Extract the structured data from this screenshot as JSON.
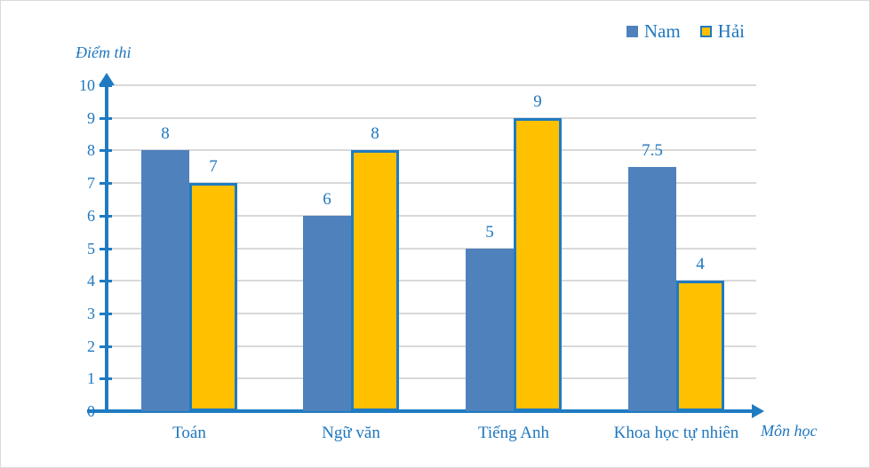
{
  "chart_data": {
    "type": "bar",
    "title": "",
    "subtitle": "",
    "xlabel": "Môn học",
    "ylabel": "Điểm thi",
    "ylim": [
      0,
      10
    ],
    "ytick_labels": [
      "10",
      "9",
      "8",
      "7",
      "6",
      "5",
      "4",
      "3",
      "2",
      "1",
      "0"
    ],
    "yticks": [
      10,
      9,
      8,
      7,
      6,
      5,
      4,
      3,
      2,
      1,
      0
    ],
    "grid": true,
    "legend_position": "top-right",
    "categories": [
      "Toán",
      "Ngữ văn",
      "Tiếng Anh",
      "Khoa học tự nhiên"
    ],
    "series": [
      {
        "name": "Nam",
        "color": "#4F81BD",
        "border_color": "",
        "values": [
          8,
          6,
          5,
          7.5
        ],
        "value_labels": [
          "8",
          "6",
          "5",
          "7.5"
        ]
      },
      {
        "name": "Hải",
        "color": "#FFC000",
        "border_color": "#1F7BC1",
        "values": [
          7,
          8,
          9,
          4
        ],
        "value_labels": [
          "7",
          "8",
          "9",
          "4"
        ]
      }
    ]
  },
  "colors": {
    "axis": "#1F7BC1",
    "text": "#1F77BE",
    "gridline": "#d9d9d9",
    "frame": "#d9d9d9",
    "series_nam": "#4F81BD",
    "series_hai": "#FFC000"
  }
}
